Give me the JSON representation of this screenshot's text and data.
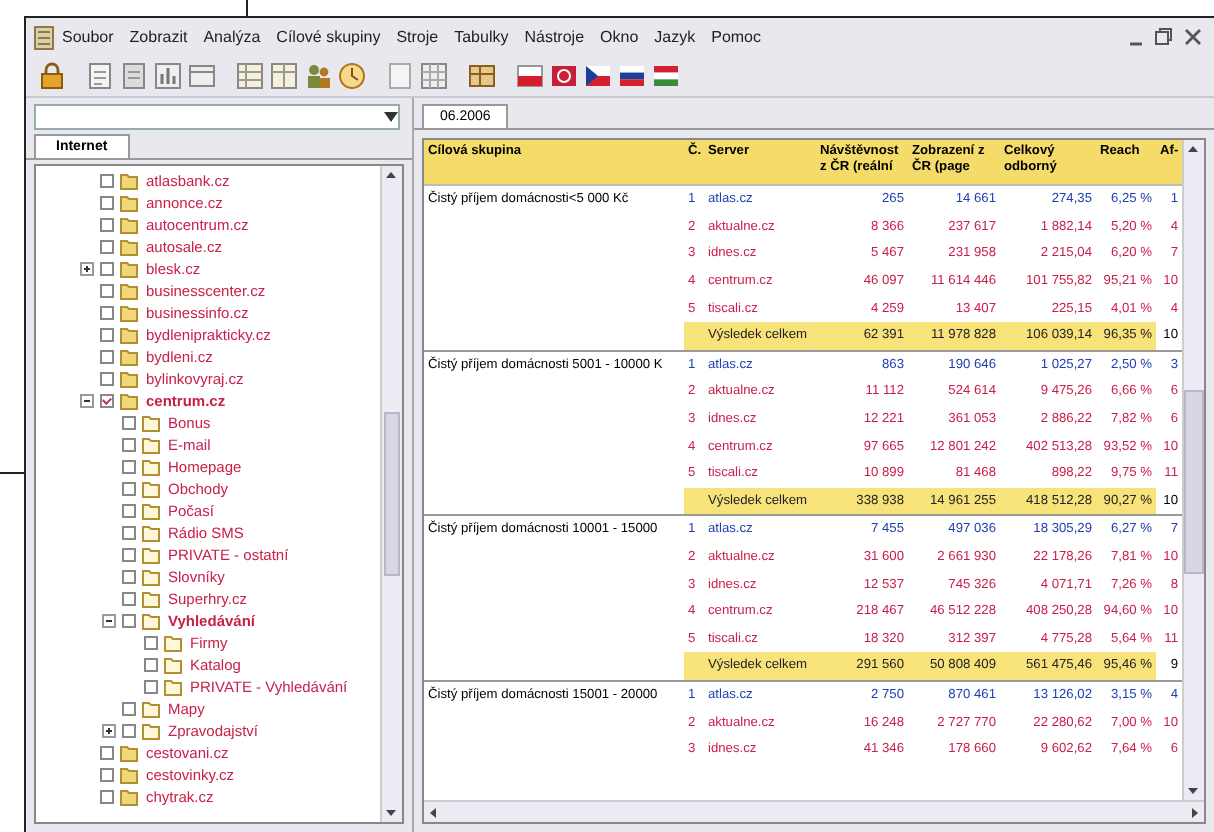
{
  "menu": [
    "Soubor",
    "Zobrazit",
    "Analýza",
    "Cílové skupiny",
    "Stroje",
    "Tabulky",
    "Nástroje",
    "Okno",
    "Jazyk",
    "Pomoc"
  ],
  "left_tabs": [
    {
      "label": "Internet",
      "selected": true
    }
  ],
  "tree": [
    {
      "label": "atlasbank.cz",
      "checked": false
    },
    {
      "label": "annonce.cz",
      "checked": false
    },
    {
      "label": "autocentrum.cz",
      "checked": false
    },
    {
      "label": "autosale.cz",
      "checked": false
    },
    {
      "label": "blesk.cz",
      "checked": false,
      "expanded": false
    },
    {
      "label": "businesscenter.cz",
      "checked": false
    },
    {
      "label": "businessinfo.cz",
      "checked": false
    },
    {
      "label": "bydleniprakticky.cz",
      "checked": false
    },
    {
      "label": "bydleni.cz",
      "checked": false
    },
    {
      "label": "bylinkovyraj.cz",
      "checked": false
    },
    {
      "label": "centrum.cz",
      "checked": true,
      "expanded": true,
      "children": [
        {
          "label": "Bonus",
          "checked": false
        },
        {
          "label": "E-mail",
          "checked": false
        },
        {
          "label": "Homepage",
          "checked": false
        },
        {
          "label": "Obchody",
          "checked": false
        },
        {
          "label": "Počasí",
          "checked": false
        },
        {
          "label": "Rádio SMS",
          "checked": false
        },
        {
          "label": "PRIVATE - ostatní",
          "checked": false
        },
        {
          "label": "Slovníky",
          "checked": false
        },
        {
          "label": "Superhry.cz",
          "checked": false
        },
        {
          "label": "Vyhledávání",
          "checked": false,
          "expanded": true,
          "children": [
            {
              "label": "Firmy",
              "checked": false
            },
            {
              "label": "Katalog",
              "checked": false
            },
            {
              "label": "PRIVATE - Vyhledávání",
              "checked": false
            }
          ]
        },
        {
          "label": "Mapy",
          "checked": false
        },
        {
          "label": "Zpravodajství",
          "checked": false,
          "expanded": false
        }
      ]
    },
    {
      "label": "cestovani.cz",
      "checked": false
    },
    {
      "label": "cestovinky.cz",
      "checked": false
    },
    {
      "label": "chytrak.cz",
      "checked": false
    }
  ],
  "document_tabs": [
    {
      "label": "06.2006",
      "selected": true
    }
  ],
  "table": {
    "columns": [
      "Cílová skupina",
      "Č.",
      "Server",
      "Návštěvnost z ČR (reální",
      "Zobrazení z ČR (page",
      "Celkový odborný",
      "Reach",
      "Af-"
    ],
    "groups": [
      {
        "label": "Čistý příjem domácnosti<5 000 Kč",
        "rows": [
          {
            "kind": "server",
            "highlighted": true,
            "cells": [
              "1",
              "atlas.cz",
              "265",
              "14 661",
              "274,35",
              "6,25 %",
              "1"
            ]
          },
          {
            "kind": "server",
            "highlighted": false,
            "cells": [
              "2",
              "aktualne.cz",
              "8 366",
              "237 617",
              "1 882,14",
              "5,20 %",
              "4"
            ]
          },
          {
            "kind": "server",
            "highlighted": false,
            "cells": [
              "3",
              "idnes.cz",
              "5 467",
              "231 958",
              "2 215,04",
              "6,20 %",
              "7"
            ]
          },
          {
            "kind": "server",
            "highlighted": false,
            "cells": [
              "4",
              "centrum.cz",
              "46 097",
              "11 614 446",
              "101 755,82",
              "95,21 %",
              "10"
            ]
          },
          {
            "kind": "server",
            "highlighted": false,
            "cells": [
              "5",
              "tiscali.cz",
              "4 259",
              "13 407",
              "225,15",
              "4,01 %",
              "4"
            ]
          },
          {
            "kind": "total",
            "cells": [
              "",
              "Výsledek celkem",
              "62 391",
              "11 978 828",
              "106 039,14",
              "96,35 %",
              "10"
            ]
          }
        ]
      },
      {
        "label": "Čistý příjem domácnosti 5001 - 10000 K",
        "rows": [
          {
            "kind": "server",
            "highlighted": true,
            "cells": [
              "1",
              "atlas.cz",
              "863",
              "190 646",
              "1 025,27",
              "2,50 %",
              "3"
            ]
          },
          {
            "kind": "server",
            "highlighted": false,
            "cells": [
              "2",
              "aktualne.cz",
              "11 112",
              "524 614",
              "9 475,26",
              "6,66 %",
              "6"
            ]
          },
          {
            "kind": "server",
            "highlighted": false,
            "cells": [
              "3",
              "idnes.cz",
              "12 221",
              "361 053",
              "2 886,22",
              "7,82 %",
              "6"
            ]
          },
          {
            "kind": "server",
            "highlighted": false,
            "cells": [
              "4",
              "centrum.cz",
              "97 665",
              "12 801 242",
              "402 513,28",
              "93,52 %",
              "10"
            ]
          },
          {
            "kind": "server",
            "highlighted": false,
            "cells": [
              "5",
              "tiscali.cz",
              "10 899",
              "81 468",
              "898,22",
              "9,75 %",
              "11"
            ]
          },
          {
            "kind": "total",
            "cells": [
              "",
              "Výsledek celkem",
              "338 938",
              "14 961 255",
              "418 512,28",
              "90,27 %",
              "10"
            ]
          }
        ]
      },
      {
        "label": "Čistý příjem domácnosti 10001 - 15000",
        "rows": [
          {
            "kind": "server",
            "highlighted": true,
            "cells": [
              "1",
              "atlas.cz",
              "7 455",
              "497 036",
              "18 305,29",
              "6,27 %",
              "7"
            ]
          },
          {
            "kind": "server",
            "highlighted": false,
            "cells": [
              "2",
              "aktualne.cz",
              "31 600",
              "2 661 930",
              "22 178,26",
              "7,81 %",
              "10"
            ]
          },
          {
            "kind": "server",
            "highlighted": false,
            "cells": [
              "3",
              "idnes.cz",
              "12 537",
              "745 326",
              "4 071,71",
              "7,26 %",
              "8"
            ]
          },
          {
            "kind": "server",
            "highlighted": false,
            "cells": [
              "4",
              "centrum.cz",
              "218 467",
              "46 512 228",
              "408 250,28",
              "94,60 %",
              "10"
            ]
          },
          {
            "kind": "server",
            "highlighted": false,
            "cells": [
              "5",
              "tiscali.cz",
              "18 320",
              "312 397",
              "4 775,28",
              "5,64 %",
              "11"
            ]
          },
          {
            "kind": "total",
            "cells": [
              "",
              "Výsledek celkem",
              "291 560",
              "50 808 409",
              "561 475,46",
              "95,46 %",
              "9"
            ]
          }
        ]
      },
      {
        "label": "Čistý příjem domácnosti 15001 - 20000",
        "rows": [
          {
            "kind": "server",
            "highlighted": true,
            "cells": [
              "1",
              "atlas.cz",
              "2 750",
              "870 461",
              "13 126,02",
              "3,15 %",
              "4"
            ]
          },
          {
            "kind": "server",
            "highlighted": false,
            "cells": [
              "2",
              "aktualne.cz",
              "16 248",
              "2 727 770",
              "22 280,62",
              "7,00 %",
              "10"
            ]
          },
          {
            "kind": "server",
            "highlighted": false,
            "cells": [
              "3",
              "idnes.cz",
              "41 346",
              "178 660",
              "9 602,62",
              "7,64 %",
              "6"
            ]
          }
        ]
      }
    ]
  }
}
